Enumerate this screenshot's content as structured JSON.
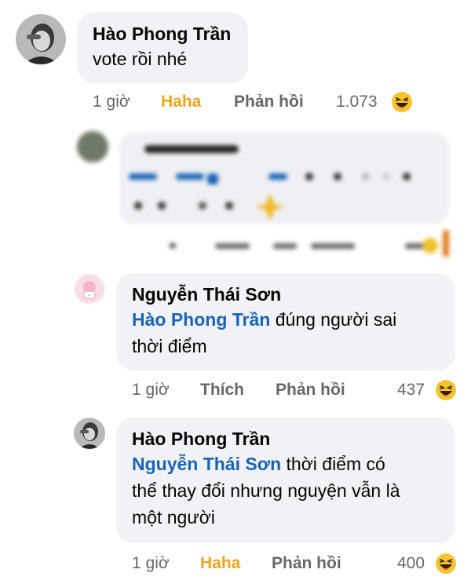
{
  "comments": [
    {
      "author": "Hào Phong Trần",
      "text": "vote rồi nhé",
      "time": "1 giờ",
      "reaction_label": "Haha",
      "reply_label": "Phản hồi",
      "reaction_count": "1.073",
      "reaction_icon": "haha-emoji-icon"
    },
    {
      "author": "Nguyễn Thái Sơn",
      "mention": "Hào Phong Trần",
      "text_line1": " đúng người sai",
      "text_line2": "thời điểm",
      "time": "1 giờ",
      "reaction_label": "Thích",
      "reply_label": "Phản hồi",
      "reaction_count": "437",
      "reaction_icon": "haha-emoji-icon"
    },
    {
      "author": "Hào Phong Trần",
      "mention": "Nguyễn Thái Sơn",
      "text_line1": " thời điểm có",
      "text_line2": "thể thay đổi nhưng nguyện vẫn là",
      "text_line3": "một người",
      "time": "1 giờ",
      "reaction_label": "Haha",
      "reply_label": "Phản hồi",
      "reaction_count": "400",
      "reaction_icon": "haha-emoji-icon"
    }
  ],
  "colors": {
    "bubble": "#f0f2f5",
    "mention": "#1a64b6",
    "haha_label": "#f0a51c",
    "meta": "#65676b"
  }
}
